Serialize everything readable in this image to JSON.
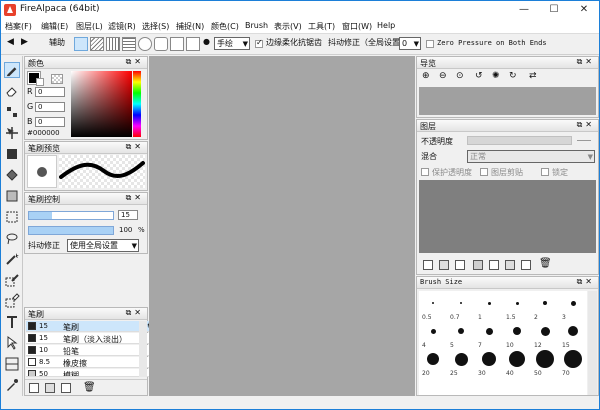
{
  "window": {
    "title": "FireAlpaca (64bit)",
    "min": "—",
    "max": "☐",
    "close": "✕"
  },
  "menu": [
    "档案(F)",
    "编辑(E)",
    "图层(L)",
    "滤镜(R)",
    "选择(S)",
    "捕捉(N)",
    "颜色(C)",
    "Brush",
    "表示(V)",
    "工具(T)",
    "窗口(W)",
    "Help"
  ],
  "toolbar": {
    "aa_label": "辅助",
    "hand_select": "手绘",
    "soften_label": "边缘柔化抗锯齿",
    "stabilizer_label": "抖动修正（全局设置）",
    "stabilizer_value": "0",
    "zero_pressure_label": "Zero Pressure on Both Ends"
  },
  "color_panel": {
    "title": "颜色",
    "r_label": "R",
    "r_value": "0",
    "g_label": "G",
    "g_value": "0",
    "b_label": "B",
    "b_value": "0",
    "hex": "#000000",
    "fg": "#000000"
  },
  "brush_preview": {
    "title": "笔刷预览"
  },
  "brush_control": {
    "title": "笔刷控制",
    "size_value": "15",
    "size_fill": 0.27,
    "opacity_value": "100",
    "opacity_unit": "%",
    "opacity_fill": 1.0,
    "stabilizer_label": "抖动修正",
    "stabilizer_select": "使用全局设置"
  },
  "brush_list": {
    "title": "笔刷",
    "items": [
      {
        "size": "15",
        "name": "笔刷",
        "swatch": "#222222",
        "selected": true
      },
      {
        "size": "15",
        "name": "笔刷（淡入淡出）",
        "swatch": "#222222",
        "selected": false
      },
      {
        "size": "10",
        "name": "铅笔",
        "swatch": "#222222",
        "selected": false
      },
      {
        "size": "8.5",
        "name": "橡皮擦",
        "swatch": "#ffffff",
        "selected": false
      },
      {
        "size": "50",
        "name": "模糊",
        "swatch": "#cccccc",
        "selected": false
      }
    ]
  },
  "navigator": {
    "title": "导览"
  },
  "layers": {
    "title": "图层",
    "opacity_label": "不透明度",
    "blend_label": "混合",
    "blend_value": "正常",
    "protect_label": "保护透明度",
    "clip_label": "图层剪贴",
    "lock_label": "锁定"
  },
  "brush_size": {
    "title": "Brush Size",
    "labels": [
      "0.5",
      "0.7",
      "1",
      "1.5",
      "2",
      "3",
      "4",
      "5",
      "7",
      "10",
      "12",
      "15",
      "20",
      "25",
      "30",
      "40",
      "50",
      "70"
    ]
  },
  "colors": {
    "accent": "#1c7fd8",
    "canvas": "#a6a6a6",
    "layer_area": "#7f7f7f",
    "nav_area": "#a0a0a0"
  }
}
